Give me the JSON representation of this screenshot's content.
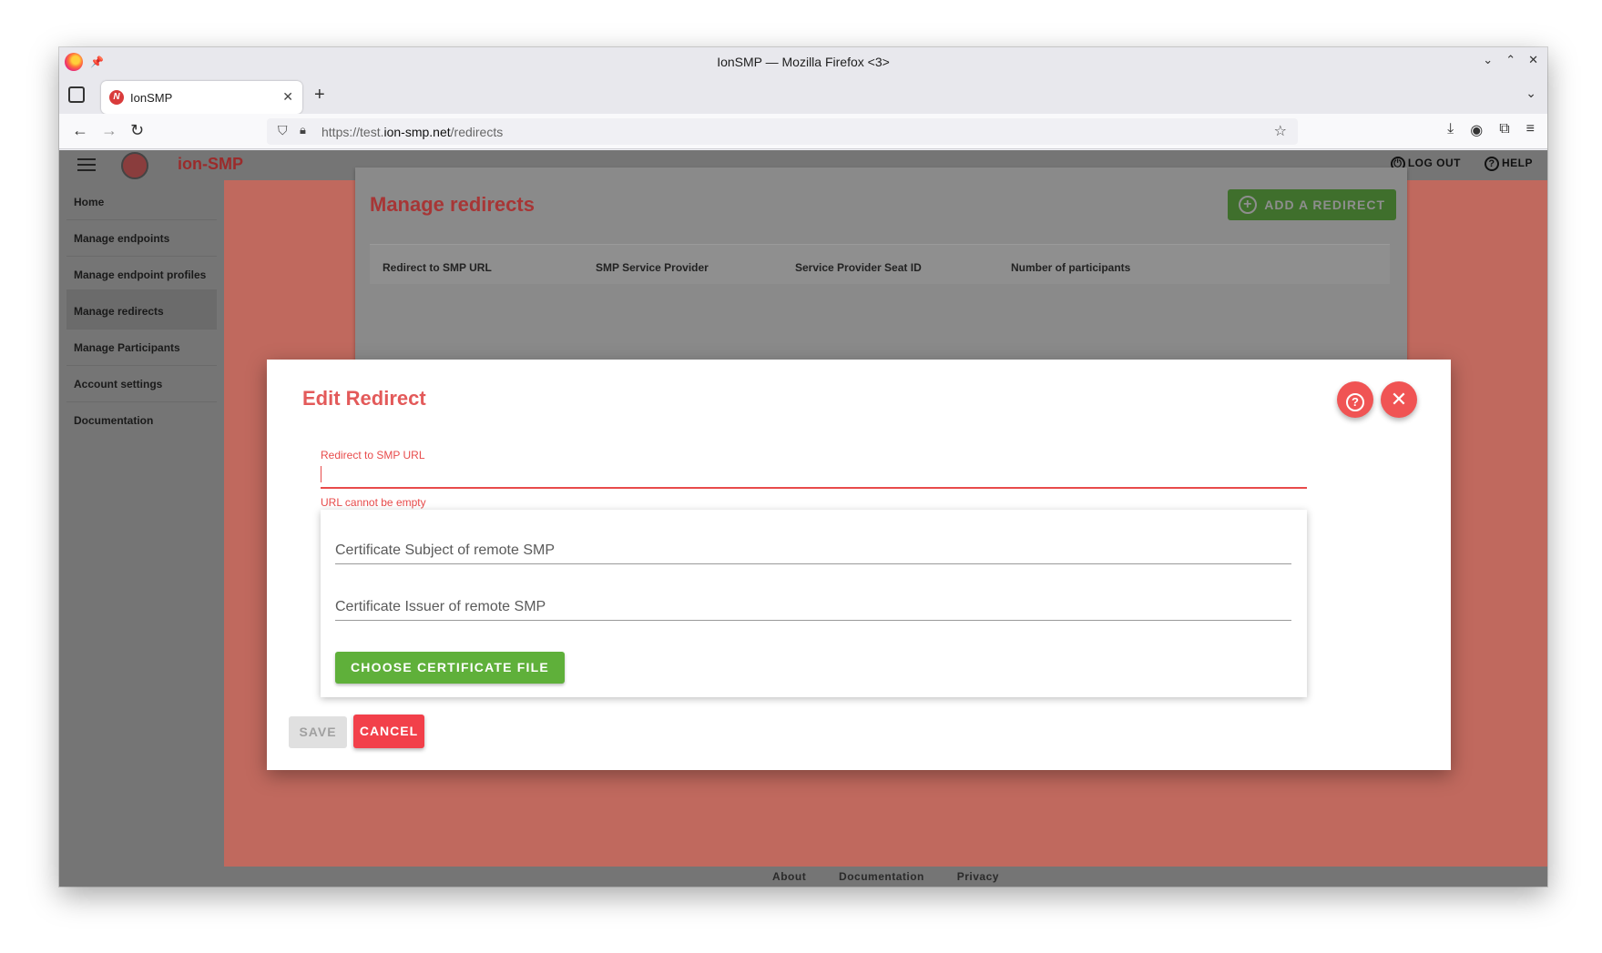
{
  "window": {
    "title": "IonSMP — Mozilla Firefox <3>"
  },
  "tab": {
    "title": "IonSMP",
    "favicon_letter": "N"
  },
  "urlbar": {
    "url_prefix": "https://test.",
    "url_domain": "ion-smp.net",
    "url_path": "/redirects"
  },
  "app": {
    "brand": "ion-SMP",
    "logout_label": "LOG OUT",
    "help_label": "HELP",
    "accent_color": "#e35a5a",
    "primary_green": "#5fb03a"
  },
  "sidebar": {
    "items": [
      {
        "label": "Home"
      },
      {
        "label": "Manage endpoints"
      },
      {
        "label": "Manage endpoint profiles"
      },
      {
        "label": "Manage redirects"
      },
      {
        "label": "Manage Participants"
      },
      {
        "label": "Account settings"
      },
      {
        "label": "Documentation"
      }
    ],
    "active": "Manage redirects"
  },
  "main": {
    "title": "Manage redirects",
    "add_button_label": "ADD A REDIRECT",
    "columns": [
      "Redirect to SMP URL",
      "SMP Service Provider",
      "Service Provider Seat ID",
      "Number of participants"
    ]
  },
  "footer": {
    "links": [
      "About",
      "Documentation",
      "Privacy"
    ]
  },
  "modal": {
    "title": "Edit Redirect",
    "url_label": "Redirect to SMP URL",
    "url_value": "",
    "url_error": "URL cannot be empty",
    "cert_subject_placeholder": "Certificate Subject of remote SMP",
    "cert_issuer_placeholder": "Certificate Issuer of remote SMP",
    "choose_cert_label": "CHOOSE CERTIFICATE FILE",
    "save_label": "SAVE",
    "cancel_label": "CANCEL"
  }
}
